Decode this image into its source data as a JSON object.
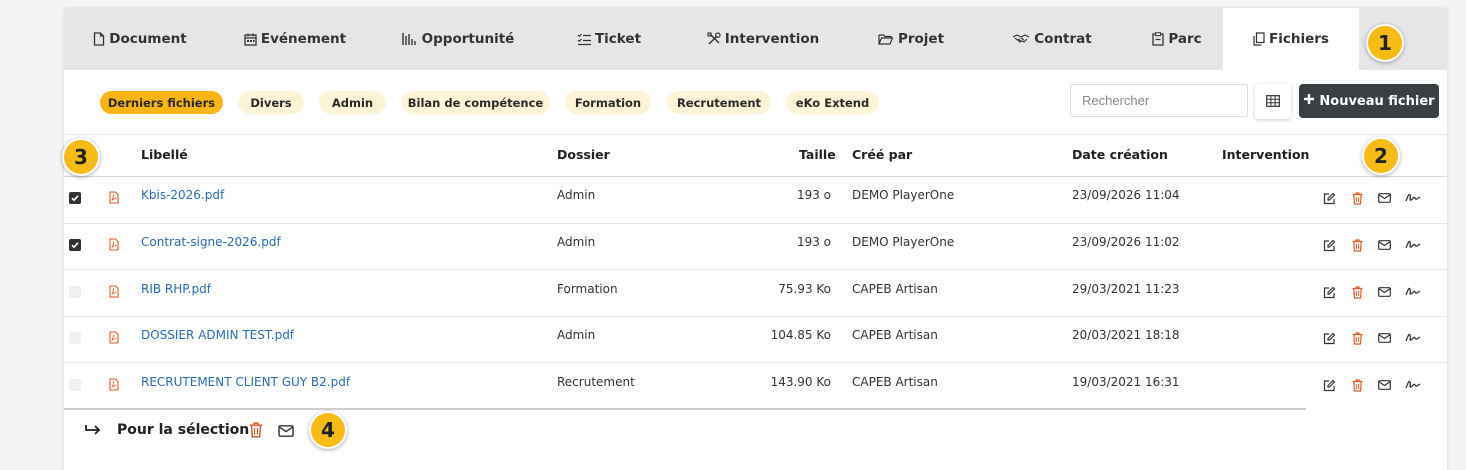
{
  "tabs": [
    {
      "label": "Document",
      "icon": "file-icon"
    },
    {
      "label": "Evénement",
      "icon": "calendar-icon"
    },
    {
      "label": "Opportunité",
      "icon": "bar-chart-icon"
    },
    {
      "label": "Ticket",
      "icon": "checklist-icon"
    },
    {
      "label": "Intervention",
      "icon": "tools-icon"
    },
    {
      "label": "Projet",
      "icon": "folder-open-icon"
    },
    {
      "label": "Contrat",
      "icon": "handshake-icon"
    },
    {
      "label": "Parc",
      "icon": "clipboard-icon"
    },
    {
      "label": "Fichiers",
      "icon": "files-icon",
      "active": true
    }
  ],
  "badges": [
    "1",
    "2",
    "3",
    "4"
  ],
  "filters": [
    "Derniers fichiers",
    "Divers",
    "Admin",
    "Bilan de compétence",
    "Formation",
    "Recrutement",
    "eKo Extend"
  ],
  "search": {
    "placeholder": "Rechercher",
    "value": ""
  },
  "new_file_label": "Nouveau fichier",
  "columns": {
    "label": "Libellé",
    "folder": "Dossier",
    "size": "Taille",
    "created_by": "Créé par",
    "date": "Date création",
    "intervention": "Intervention"
  },
  "rows": [
    {
      "checked": true,
      "name": "Kbis-2026.pdf",
      "folder": "Admin",
      "size": "193 o",
      "created_by": "DEMO PlayerOne",
      "date": "23/09/2026 11:04",
      "intervention": ""
    },
    {
      "checked": true,
      "name": "Contrat-signe-2026.pdf",
      "folder": "Admin",
      "size": "193 o",
      "created_by": "DEMO PlayerOne",
      "date": "23/09/2026 11:02",
      "intervention": ""
    },
    {
      "checked": false,
      "name": "RIB RHP.pdf",
      "folder": "Formation",
      "size": "75.93 Ko",
      "created_by": "CAPEB Artisan",
      "date": "29/03/2021 11:23",
      "intervention": ""
    },
    {
      "checked": false,
      "name": "DOSSIER ADMIN TEST.pdf",
      "folder": "Admin",
      "size": "104.85 Ko",
      "created_by": "CAPEB Artisan",
      "date": "20/03/2021 18:18",
      "intervention": ""
    },
    {
      "checked": false,
      "name": "RECRUTEMENT CLIENT GUY B2.pdf",
      "folder": "Recrutement",
      "size": "143.90 Ko",
      "created_by": "CAPEB Artisan",
      "date": "19/03/2021 16:31",
      "intervention": ""
    }
  ],
  "row_actions": [
    "edit-icon",
    "trash-icon",
    "mail-icon",
    "signature-icon"
  ],
  "footer": {
    "label": "Pour la sélection",
    "actions": [
      "trash-icon",
      "mail-icon"
    ]
  },
  "colors": {
    "accent": "#f7bb15",
    "chip_bg": "#fdf3d6",
    "link": "#2a6bb3",
    "danger": "#e05a24",
    "dark_button": "#3a3f44"
  }
}
